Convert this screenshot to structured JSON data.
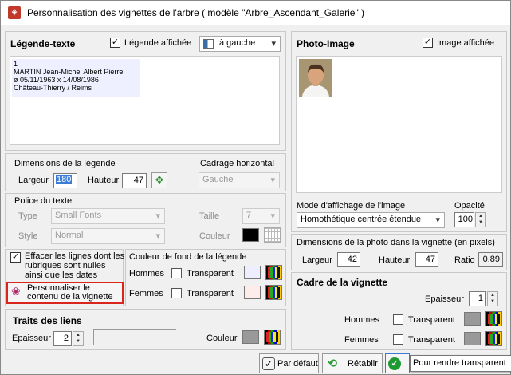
{
  "window": {
    "title": "Personnalisation des vignettes de l'arbre ( modèle \"Arbre_Ascendant_Galerie\" )"
  },
  "legend": {
    "title": "Légende-texte",
    "show_label": "Légende affichée",
    "show_checked": true,
    "position": "à gauche",
    "preview_lines": [
      "1",
      "MARTIN Jean-Michel Albert Pierre",
      "ø 05/11/1963  x 14/08/1986",
      "Château-Thierry / Reims"
    ],
    "dimensions_title": "Dimensions de la légende",
    "width_label": "Largeur",
    "width_value": "180",
    "height_label": "Hauteur",
    "height_value": "47",
    "framing_title": "Cadrage horizontal",
    "framing_value": "Gauche"
  },
  "font": {
    "title": "Police du texte",
    "type_label": "Type",
    "type_value": "Small Fonts",
    "size_label": "Taille",
    "size_value": "7",
    "style_label": "Style",
    "style_value": "Normal",
    "color_label": "Couleur",
    "color": "#000000"
  },
  "options": {
    "erase_label": "Effacer les lignes dont les rubriques sont nulles ainsi que les dates inconnues",
    "erase_checked": true,
    "customize_label": "Personnaliser le contenu de la vignette"
  },
  "background": {
    "title": "Couleur de fond de la légende",
    "men_label": "Hommes",
    "women_label": "Femmes",
    "transparent_label": "Transparent",
    "men_color": "#eeeeff",
    "women_color": "#fdecea"
  },
  "links": {
    "title": "Traits des liens",
    "thickness_label": "Epaisseur",
    "thickness_value": "2",
    "color_label": "Couleur",
    "color": "#999999"
  },
  "photo": {
    "title": "Photo-Image",
    "show_label": "Image affichée",
    "show_checked": true,
    "mode_label": "Mode d'affichage de l'image",
    "mode_value": "Homothétique centrée étendue",
    "opacity_label": "Opacité",
    "opacity_value": "100",
    "dims_title": "Dimensions de la photo dans la vignette (en pixels)",
    "width_label": "Largeur",
    "width_value": "42",
    "height_label": "Hauteur",
    "height_value": "47",
    "ratio_label": "Ratio",
    "ratio_value": "0,89"
  },
  "frame": {
    "title": "Cadre de la vignette",
    "thickness_label": "Epaisseur",
    "thickness_value": "1",
    "men_label": "Hommes",
    "women_label": "Femmes",
    "transparent_label": "Transparent",
    "men_color": "#999999",
    "women_color": "#999999"
  },
  "buttons": {
    "default": "Par défaut",
    "restore": "Rétablir",
    "tooltip": "Pour rendre transparent"
  }
}
